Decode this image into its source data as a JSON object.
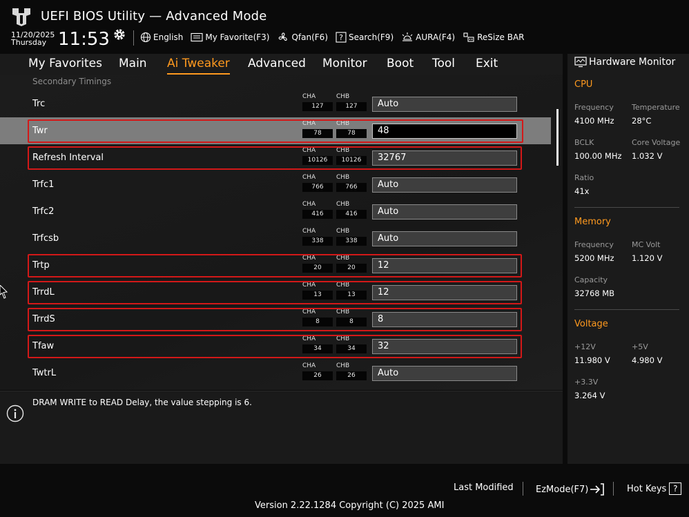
{
  "header": {
    "title": "UEFI BIOS Utility — Advanced Mode",
    "date": "11/20/2025",
    "day": "Thursday",
    "time": "11:53",
    "toolbar": [
      {
        "label": "English",
        "icon": "globe-icon"
      },
      {
        "label": "My Favorite(F3)",
        "icon": "favorite-icon"
      },
      {
        "label": "Qfan(F6)",
        "icon": "fan-icon"
      },
      {
        "label": "Search(F9)",
        "icon": "search-icon"
      },
      {
        "label": "AURA(F4)",
        "icon": "aura-icon"
      },
      {
        "label": "ReSize BAR",
        "icon": "resize-bar-icon"
      }
    ]
  },
  "nav": {
    "tabs": [
      "My Favorites",
      "Main",
      "Ai Tweaker",
      "Advanced",
      "Monitor",
      "Boot",
      "Tool",
      "Exit"
    ],
    "active": "Ai Tweaker"
  },
  "main": {
    "section_label": "Secondary Timings",
    "channel_labels": {
      "a": "CHA",
      "b": "CHB"
    },
    "rows": [
      {
        "label": "Trc",
        "cha": "127",
        "chb": "127",
        "value": "Auto"
      },
      {
        "label": "Twr",
        "cha": "78",
        "chb": "78",
        "value": "48"
      },
      {
        "label": "Refresh Interval",
        "cha": "10126",
        "chb": "10126",
        "value": "32767"
      },
      {
        "label": "Trfc1",
        "cha": "766",
        "chb": "766",
        "value": "Auto"
      },
      {
        "label": "Trfc2",
        "cha": "416",
        "chb": "416",
        "value": "Auto"
      },
      {
        "label": "Trfcsb",
        "cha": "338",
        "chb": "338",
        "value": "Auto"
      },
      {
        "label": "Trtp",
        "cha": "20",
        "chb": "20",
        "value": "12"
      },
      {
        "label": "TrrdL",
        "cha": "13",
        "chb": "13",
        "value": "12"
      },
      {
        "label": "TrrdS",
        "cha": "8",
        "chb": "8",
        "value": "8"
      },
      {
        "label": "Tfaw",
        "cha": "34",
        "chb": "34",
        "value": "32"
      },
      {
        "label": "TwtrL",
        "cha": "26",
        "chb": "26",
        "value": "Auto"
      }
    ]
  },
  "help": {
    "text": "DRAM WRITE to READ Delay, the value stepping is 6."
  },
  "hardware_monitor": {
    "title": "Hardware Monitor",
    "cpu": {
      "heading": "CPU",
      "frequency_label": "Frequency",
      "frequency": "4100 MHz",
      "temperature_label": "Temperature",
      "temperature": "28°C",
      "bclk_label": "BCLK",
      "bclk": "100.00 MHz",
      "core_voltage_label": "Core Voltage",
      "core_voltage": "1.032 V",
      "ratio_label": "Ratio",
      "ratio": "41x"
    },
    "memory": {
      "heading": "Memory",
      "frequency_label": "Frequency",
      "frequency": "5200 MHz",
      "mc_volt_label": "MC Volt",
      "mc_volt": "1.120 V",
      "capacity_label": "Capacity",
      "capacity": "32768 MB"
    },
    "voltage": {
      "heading": "Voltage",
      "v12_label": "+12V",
      "v12": "11.980 V",
      "v5_label": "+5V",
      "v5": "4.980 V",
      "v33_label": "+3.3V",
      "v33": "3.264 V"
    }
  },
  "footer": {
    "last_modified": "Last Modified",
    "ezmode": "EzMode(F7)",
    "hot_keys": "Hot Keys",
    "hot_keys_key": "?",
    "version": "Version 2.22.1284 Copyright (C) 2025 AMI"
  },
  "colors": {
    "accent": "#ff9a1f",
    "highlight_border": "#d31818",
    "selected_row": "#7d7d7d"
  }
}
